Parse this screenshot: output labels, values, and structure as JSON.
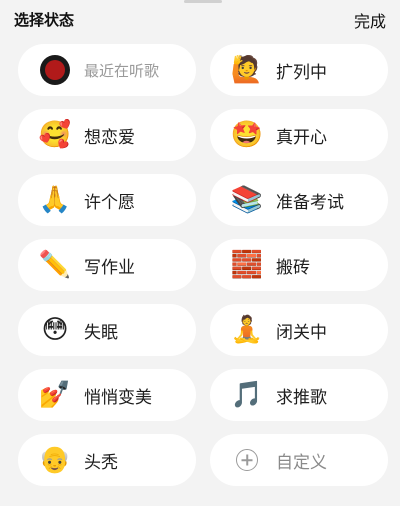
{
  "header": {
    "title": "选择状态",
    "done_label": "完成"
  },
  "statuses": [
    {
      "icon": "",
      "icon_name": "record-icon",
      "label": "最近在听歌"
    },
    {
      "icon": "🙋",
      "icon_name": "person-raising-hand-icon",
      "label": "扩列中"
    },
    {
      "icon": "🥰",
      "icon_name": "smiling-face-with-hearts-icon",
      "label": "想恋爱"
    },
    {
      "icon": "🤩",
      "icon_name": "star-struck-icon",
      "label": "真开心"
    },
    {
      "icon": "🙏",
      "icon_name": "folded-hands-icon",
      "label": "许个愿"
    },
    {
      "icon": "📚",
      "icon_name": "books-icon",
      "label": "准备考试"
    },
    {
      "icon": "✏️",
      "icon_name": "pencil-icon",
      "label": "写作业"
    },
    {
      "icon": "🧱",
      "icon_name": "bricks-icon",
      "label": "搬砖"
    },
    {
      "icon": "😳",
      "icon_name": "flushed-face-icon",
      "label": "失眠"
    },
    {
      "icon": "🧘",
      "icon_name": "person-meditating-icon",
      "label": "闭关中"
    },
    {
      "icon": "💅",
      "icon_name": "nail-polish-icon",
      "label": "悄悄变美"
    },
    {
      "icon": "🎵",
      "icon_name": "musical-note-icon",
      "label": "求推歌"
    },
    {
      "icon": "👴",
      "icon_name": "old-man-icon",
      "label": "头秃"
    },
    {
      "icon": "",
      "icon_name": "plus-circle-icon",
      "label": "自定义"
    }
  ],
  "colors": {
    "background": "#f3f3f3",
    "chip": "#ffffff",
    "muted_text": "#9a9a9a"
  }
}
